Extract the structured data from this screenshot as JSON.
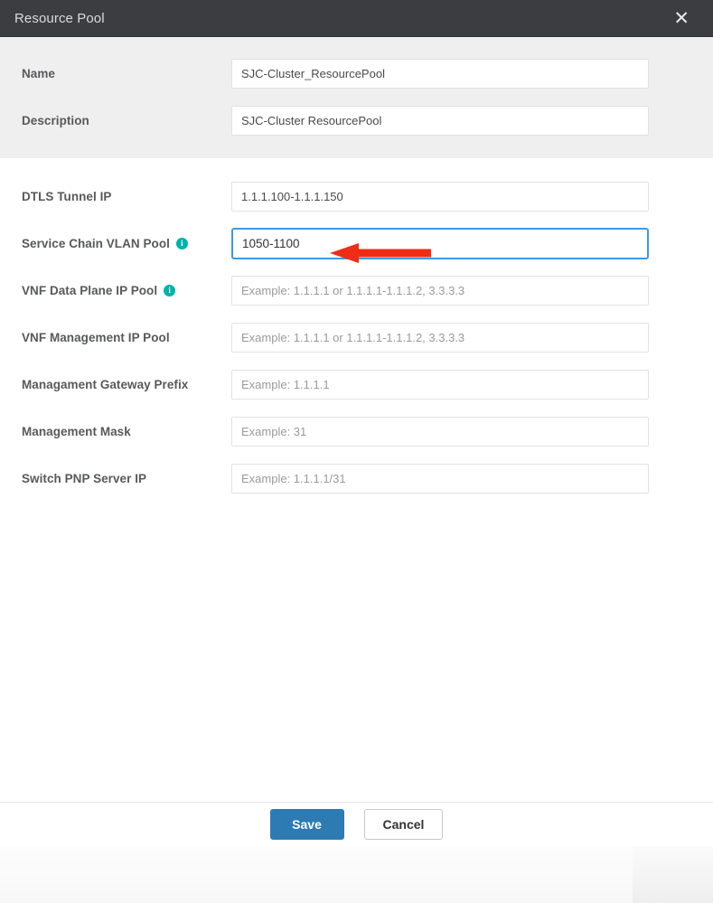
{
  "header": {
    "title": "Resource Pool",
    "close_label": "✕",
    "close_icon": "close-icon"
  },
  "colors": {
    "header_bg": "#3b3d41",
    "section_gray_bg": "#efefef",
    "info_icon": "#00b2a9",
    "focus_border": "#3b9ae9",
    "save_button": "#2d7bb2",
    "annotation_arrow": "#f02c16"
  },
  "gray_section": {
    "fields": [
      {
        "label": "Name",
        "value": "SJC-Cluster_ResourcePool",
        "placeholder": "",
        "has_info": false,
        "focused": false
      },
      {
        "label": "Description",
        "value": "SJC-Cluster ResourcePool",
        "placeholder": "",
        "has_info": false,
        "focused": false
      }
    ]
  },
  "white_section": {
    "fields": [
      {
        "label": "DTLS Tunnel IP",
        "value": "1.1.1.100-1.1.1.150",
        "placeholder": "",
        "has_info": false,
        "focused": false
      },
      {
        "label": "Service Chain VLAN Pool",
        "value": "1050-1100",
        "placeholder": "",
        "has_info": true,
        "focused": true
      },
      {
        "label": "VNF Data Plane IP Pool",
        "value": "",
        "placeholder": "Example: 1.1.1.1 or 1.1.1.1-1.1.1.2, 3.3.3.3",
        "has_info": true,
        "focused": false
      },
      {
        "label": "VNF Management IP Pool",
        "value": "",
        "placeholder": "Example: 1.1.1.1 or 1.1.1.1-1.1.1.2, 3.3.3.3",
        "has_info": false,
        "focused": false
      },
      {
        "label": "Managament Gateway Prefix",
        "value": "",
        "placeholder": "Example: 1.1.1.1",
        "has_info": false,
        "focused": false
      },
      {
        "label": "Management Mask",
        "value": "",
        "placeholder": "Example: 31",
        "has_info": false,
        "focused": false
      },
      {
        "label": "Switch PNP Server IP",
        "value": "",
        "placeholder": "Example: 1.1.1.1/31",
        "has_info": false,
        "focused": false
      }
    ]
  },
  "info_icon_glyph": "i",
  "footer": {
    "save_label": "Save",
    "cancel_label": "Cancel"
  },
  "annotation": {
    "type": "arrow-left",
    "points_to": "Service Chain VLAN Pool"
  }
}
